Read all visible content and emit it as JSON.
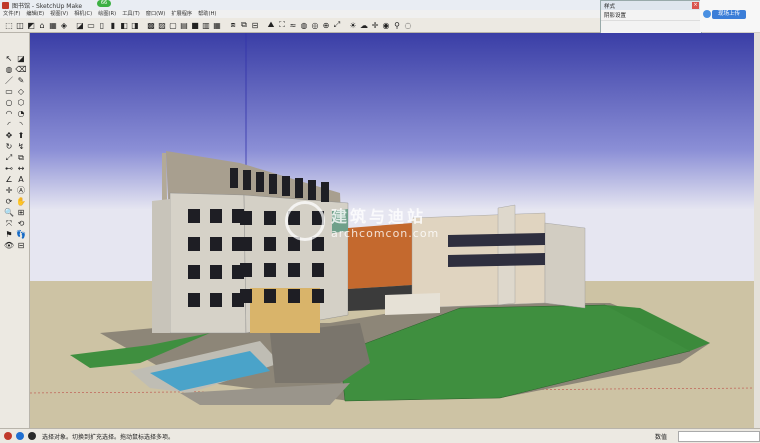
{
  "window": {
    "title": "图书馆 - SketchUp Make",
    "badge": "66"
  },
  "menu": [
    "文件(F)",
    "编辑(E)",
    "视图(V)",
    "相机(C)",
    "绘图(R)",
    "工具(T)",
    "窗口(W)",
    "扩展程序",
    "帮助(H)"
  ],
  "toolbar_icons": [
    "select-icon",
    "eraser-icon",
    "paint-icon",
    "house-icon",
    "warehouse-icon",
    "component-icon",
    "sep",
    "iso-view-icon",
    "top-view-icon",
    "front-view-icon",
    "right-view-icon",
    "back-view-icon",
    "left-view-icon",
    "sep",
    "xray-icon",
    "backedge-icon",
    "wireframe-icon",
    "hidden-line-icon",
    "shaded-icon",
    "textured-icon",
    "monochrome-icon",
    "sep",
    "section-plane-icon",
    "section-display-icon",
    "section-cut-icon",
    "sep",
    "sandbox-contour-icon",
    "sandbox-scratch-icon",
    "smoove-icon",
    "stamp-icon",
    "drape-icon",
    "add-detail-icon",
    "flip-edge-icon",
    "sep",
    "shadow-icon",
    "fog-icon",
    "axes-icon",
    "camera-icon",
    "walk-icon",
    "look-icon"
  ],
  "left_tools": [
    "select-tool-icon",
    "component-tool-icon",
    "paint-bucket-icon",
    "eraser-tool-icon",
    "line-tool-icon",
    "freehand-tool-icon",
    "rectangle-tool-icon",
    "rotated-rect-icon",
    "circle-tool-icon",
    "polygon-tool-icon",
    "arc-tool-icon",
    "pie-tool-icon",
    "two-point-arc-icon",
    "three-point-arc-icon",
    "move-tool-icon",
    "pushpull-tool-icon",
    "rotate-tool-icon",
    "followme-tool-icon",
    "scale-tool-icon",
    "offset-tool-icon",
    "tape-measure-icon",
    "dimension-icon",
    "protractor-icon",
    "text-tool-icon",
    "axes-tool-icon",
    "3dtext-icon",
    "orbit-tool-icon",
    "pan-tool-icon",
    "zoom-tool-icon",
    "zoom-window-icon",
    "zoom-extents-icon",
    "previous-view-icon",
    "position-camera-icon",
    "walk-tool-icon",
    "look-around-icon",
    "section-tool-icon"
  ],
  "panel": {
    "title": "样式",
    "row": "阴影设置"
  },
  "upload": {
    "label": "现场上传"
  },
  "watermark": {
    "line1": "建筑与迪站",
    "line2": "archcomcon.com"
  },
  "status": {
    "message": "选择对象。切换到扩充选择。拖动鼠标选择多项。",
    "measurements_label": "数值"
  },
  "colors": {
    "sky_top": "#3b3fa8",
    "sky_bottom": "#e9e9f3",
    "ground": "#cfc4a6",
    "grass": "#3f8f3f",
    "facade": "#d8d4cc"
  }
}
